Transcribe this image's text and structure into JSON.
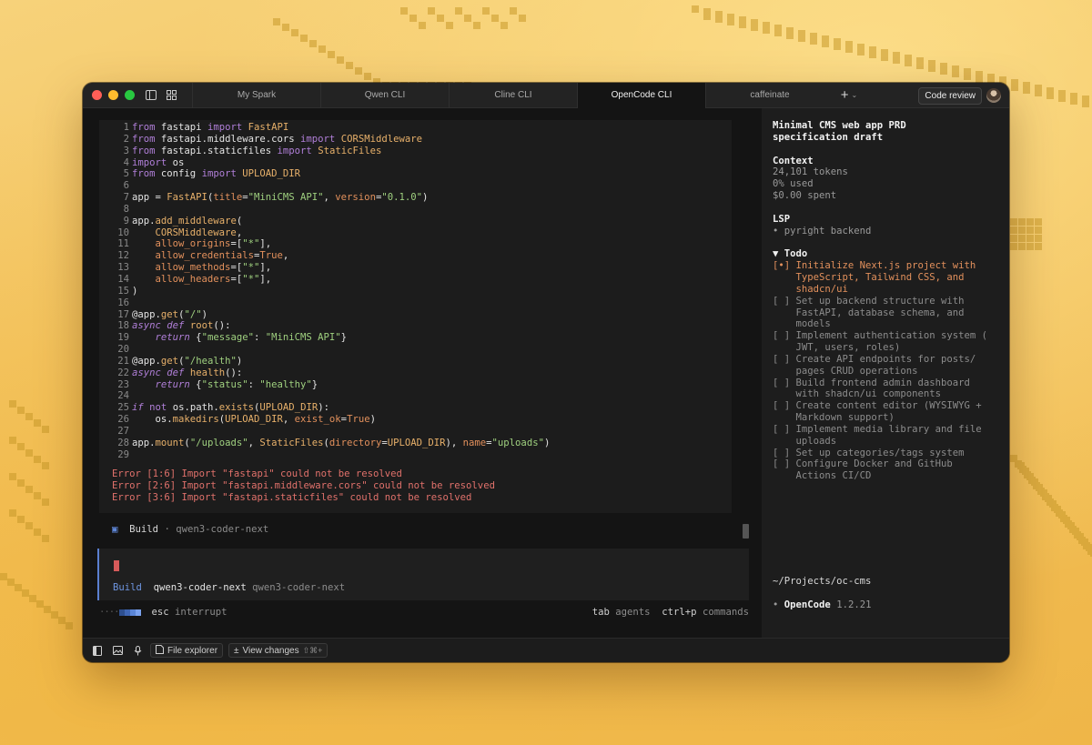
{
  "window": {
    "tabs": [
      "My Spark",
      "Qwen CLI",
      "Cline CLI",
      "OpenCode CLI",
      "caffeinate"
    ],
    "active_tab": "OpenCode CLI",
    "code_review_label": "Code review"
  },
  "editor": {
    "lines": [
      {
        "n": "1",
        "t": "from fastapi import FastAPI"
      },
      {
        "n": "2",
        "t": "from fastapi.middleware.cors import CORSMiddleware"
      },
      {
        "n": "3",
        "t": "from fastapi.staticfiles import StaticFiles"
      },
      {
        "n": "4",
        "t": "import os"
      },
      {
        "n": "5",
        "t": "from config import UPLOAD_DIR"
      },
      {
        "n": "6",
        "t": ""
      },
      {
        "n": "7",
        "t": "app = FastAPI(title=\"MiniCMS API\", version=\"0.1.0\")"
      },
      {
        "n": "8",
        "t": ""
      },
      {
        "n": "9",
        "t": "app.add_middleware("
      },
      {
        "n": "10",
        "t": "    CORSMiddleware,"
      },
      {
        "n": "11",
        "t": "    allow_origins=[\"*\"],"
      },
      {
        "n": "12",
        "t": "    allow_credentials=True,"
      },
      {
        "n": "13",
        "t": "    allow_methods=[\"*\"],"
      },
      {
        "n": "14",
        "t": "    allow_headers=[\"*\"],"
      },
      {
        "n": "15",
        "t": ")"
      },
      {
        "n": "16",
        "t": ""
      },
      {
        "n": "17",
        "t": "@app.get(\"/\")"
      },
      {
        "n": "18",
        "t": "async def root():"
      },
      {
        "n": "19",
        "t": "    return {\"message\": \"MiniCMS API\"}"
      },
      {
        "n": "20",
        "t": ""
      },
      {
        "n": "21",
        "t": "@app.get(\"/health\")"
      },
      {
        "n": "22",
        "t": "async def health():"
      },
      {
        "n": "23",
        "t": "    return {\"status\": \"healthy\"}"
      },
      {
        "n": "24",
        "t": ""
      },
      {
        "n": "25",
        "t": "if not os.path.exists(UPLOAD_DIR):"
      },
      {
        "n": "26",
        "t": "    os.makedirs(UPLOAD_DIR, exist_ok=True)"
      },
      {
        "n": "27",
        "t": ""
      },
      {
        "n": "28",
        "t": "app.mount(\"/uploads\", StaticFiles(directory=UPLOAD_DIR), name=\"uploads\")"
      },
      {
        "n": "29",
        "t": ""
      }
    ],
    "errors": [
      "Error [1:6] Import \"fastapi\" could not be resolved",
      "Error [2:6] Import \"fastapi.middleware.cors\" could not be resolved",
      "Error [3:6] Import \"fastapi.staticfiles\" could not be resolved"
    ]
  },
  "build_line": {
    "icon": "▣",
    "label": "Build",
    "sep": "·",
    "model": "qwen3-coder-next"
  },
  "input": {
    "mode": "Build",
    "model": "qwen3-coder-next",
    "model_dim": "qwen3-coder-next"
  },
  "footer": {
    "esc": "esc",
    "esc_label": "interrupt",
    "tab": "tab",
    "tab_label": "agents",
    "ctrl": "ctrl+p",
    "ctrl_label": "commands"
  },
  "panel": {
    "title_1": "Minimal CMS web app PRD",
    "title_2": "specification draft",
    "context_heading": "Context",
    "tokens": "24,101 tokens",
    "used": "0% used",
    "spent": "$0.00 spent",
    "lsp_heading": "LSP",
    "lsp_item": "• pyright backend",
    "todo_heading": "▼ Todo",
    "todos": [
      [
        "[•] Initialize Next.js project with",
        "    TypeScript, Tailwind CSS, and",
        "    shadcn/ui"
      ],
      [
        "[ ] Set up backend structure with",
        "    FastAPI, database schema, and",
        "    models"
      ],
      [
        "[ ] Implement authentication system (",
        "    JWT, users, roles)"
      ],
      [
        "[ ] Create API endpoints for posts/",
        "    pages CRUD operations"
      ],
      [
        "[ ] Build frontend admin dashboard",
        "    with shadcn/ui components"
      ],
      [
        "[ ] Create content editor (WYSIWYG +",
        "    Markdown support)"
      ],
      [
        "[ ] Implement media library and file",
        "    uploads"
      ],
      [
        "[ ] Set up categories/tags system"
      ],
      [
        "[ ] Configure Docker and GitHub",
        "    Actions CI/CD"
      ]
    ],
    "project_path": "~/Projects/oc-cms",
    "app_bullet": "•",
    "app_name": "OpenCode",
    "version": "1.2.21"
  },
  "statusbar": {
    "file_explorer": "File explorer",
    "view_changes": "View changes",
    "shortcut": "⇧⌘+"
  },
  "colors": {
    "accent": "#5b7fd0",
    "error": "#e0716b",
    "todo_active": "#e2905c"
  }
}
